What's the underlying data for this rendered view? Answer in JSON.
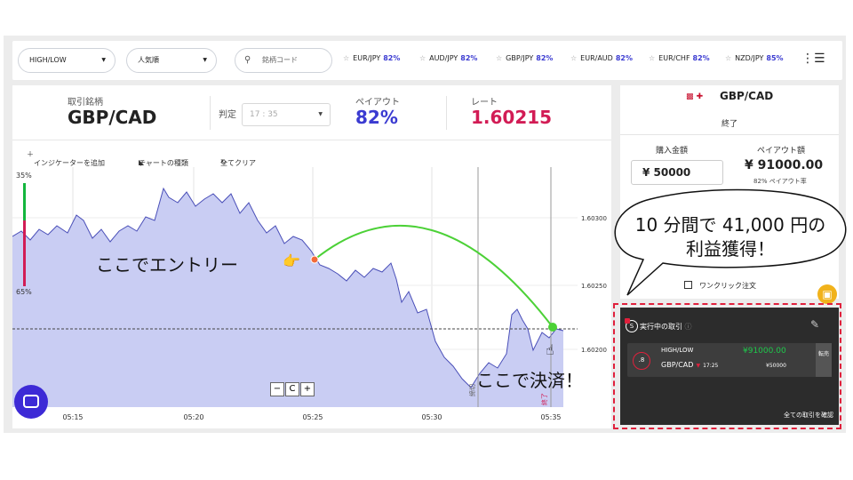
{
  "topbar": {
    "mode_select": "HIGH/LOW",
    "sort_select": "人気順",
    "search_placeholder": "銘柄コード",
    "favorites": [
      {
        "pair": "EUR/JPY",
        "payout": "82%"
      },
      {
        "pair": "AUD/JPY",
        "payout": "82%"
      },
      {
        "pair": "GBP/JPY",
        "payout": "82%"
      },
      {
        "pair": "EUR/AUD",
        "payout": "82%"
      },
      {
        "pair": "EUR/CHF",
        "payout": "82%"
      },
      {
        "pair": "NZD/JPY",
        "payout": "85%"
      }
    ]
  },
  "info": {
    "asset_label": "取引銘柄",
    "asset": "GBP/CAD",
    "judge_label": "判定",
    "judge_value": "17 : 35",
    "payout_label": "ペイアウト",
    "payout": "82%",
    "rate_label": "レート",
    "rate": "1.60215"
  },
  "toolbar": {
    "add_indicator": "インジケーターを追加",
    "chart_type": "チャートの種類",
    "clear_all": "全てクリア"
  },
  "chart_data": {
    "type": "area",
    "x_ticks": [
      "05:15",
      "05:20",
      "05:25",
      "05:30",
      "05:35"
    ],
    "y_ticks": [
      "1.60300",
      "1.60250",
      "1.60200"
    ],
    "sentiment_high": "35%",
    "sentiment_low": "65%",
    "entry_time": "05:25",
    "close_time": "05:35",
    "vertical_labels": [
      "締切",
      "終了"
    ],
    "series_color": "#c9cdf3",
    "line_color": "#4a4fb8"
  },
  "annotations": {
    "entry": "ここでエントリー",
    "close": "ここで決済！",
    "bubble_line1": "10 分間で 41,000 円の",
    "bubble_line2": "利益獲得！"
  },
  "right_panel": {
    "pair": "GBP/CAD",
    "status": "終了",
    "purchase_label": "購入金額",
    "payout_label": "ペイアウト額",
    "amount": "¥ 50000",
    "payout_amount": "¥ 91000.00",
    "payout_rate": "82% ペイアウト率",
    "oneclick": "ワンクリック注文"
  },
  "trades": {
    "title": "実行中の取引",
    "count": "1",
    "type": "HIGH/LOW",
    "profit": "¥91000.00",
    "timer": ".8",
    "pair": "GBP/CAD",
    "time": "17:25",
    "stake": "¥50000",
    "sell": "転売",
    "view_all": "全ての取引を確認"
  },
  "zoom": {
    "minus": "−",
    "reset": "C",
    "plus": "+"
  }
}
